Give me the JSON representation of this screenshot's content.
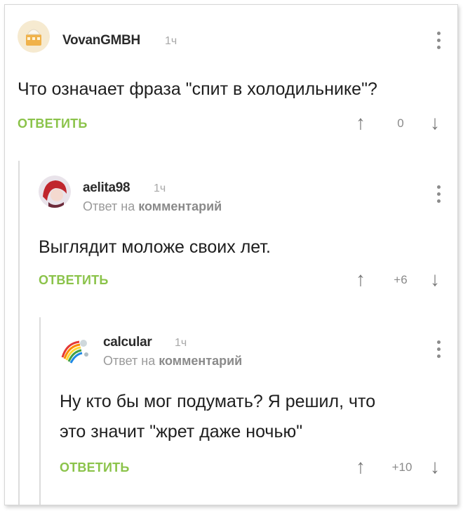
{
  "comments": [
    {
      "username": "VovanGMBH",
      "time": "1ч",
      "text": "Что означает фраза \"спит в холодильнике\"?",
      "reply_label": "ОТВЕТИТЬ",
      "rating": "0"
    },
    {
      "username": "aelita98",
      "time": "1ч",
      "reply_to_prefix": "Ответ на",
      "reply_to_target": "комментарий",
      "text": "Выглядит моложе своих лет.",
      "reply_label": "ОТВЕТИТЬ",
      "rating": "+6"
    },
    {
      "username": "calcular",
      "time": "1ч",
      "reply_to_prefix": "Ответ на",
      "reply_to_target": "комментарий",
      "text_line1": "Ну кто бы мог подумать? Я решил, что",
      "text_line2": "это значит \"жрет даже ночью\"",
      "reply_label": "ОТВЕТИТЬ",
      "rating": "+10"
    }
  ],
  "icons": {
    "upvote": "arrow-up-icon",
    "downvote": "arrow-down-icon",
    "more": "more-vertical-icon"
  },
  "colors": {
    "reply": "#8bc34a",
    "thread_line": "#dcdcdc"
  }
}
